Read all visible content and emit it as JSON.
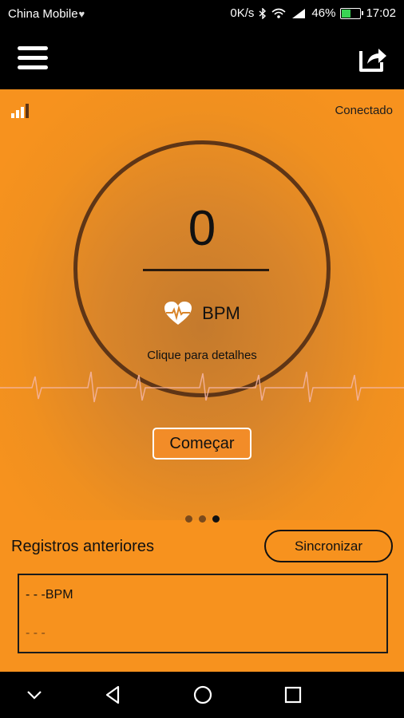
{
  "status_bar": {
    "carrier": "China Mobile",
    "speed": "0K/s",
    "signal_type": "4G",
    "battery": "46%",
    "time": "17:02"
  },
  "header": {
    "menu_icon": "hamburger-menu-icon",
    "share_icon": "share-icon"
  },
  "main": {
    "connection_status": "Conectado",
    "heart_rate_value": "0",
    "unit": "BPM",
    "details_hint": "Clique para detalhes",
    "start_label": "Começar",
    "page_indicator": {
      "count": 3,
      "active_index": 2
    }
  },
  "records": {
    "title": "Registros anteriores",
    "sync_label": "Sincronizar",
    "line1": "- - -BPM",
    "line2": "- - -"
  },
  "colors": {
    "accent": "#f7921e",
    "dark": "#000000",
    "circle": "#5e3516"
  }
}
